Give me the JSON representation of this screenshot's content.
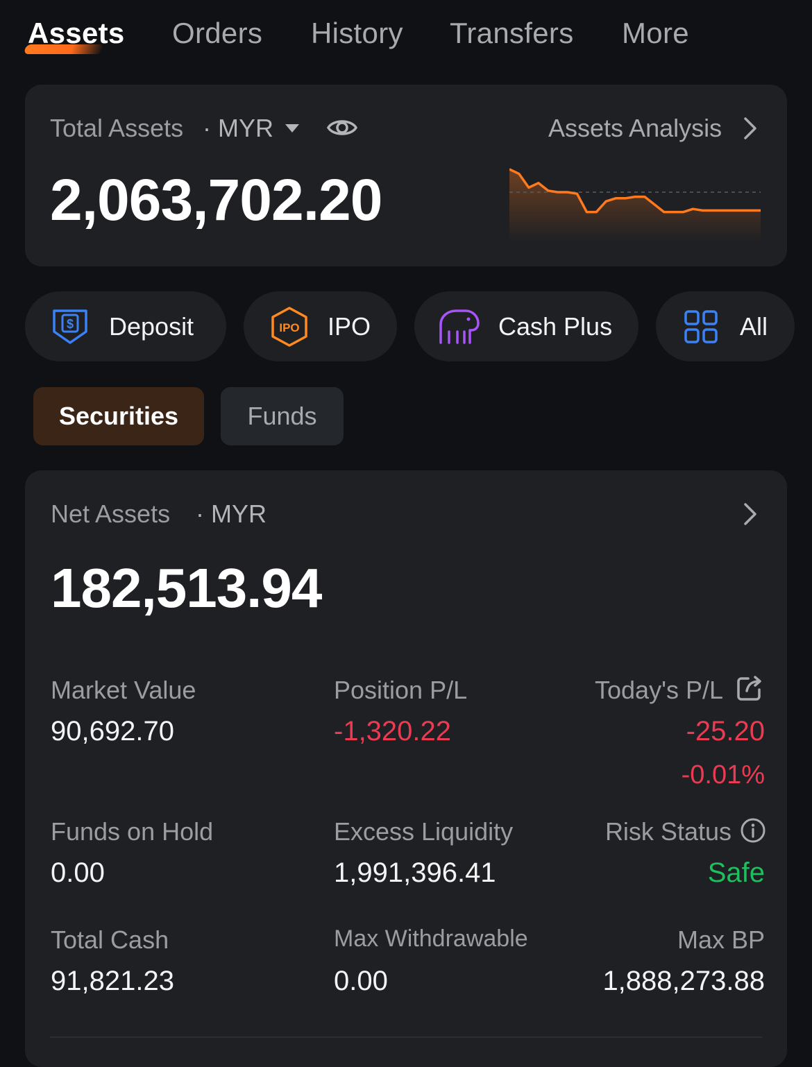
{
  "tabs": [
    {
      "label": "Assets",
      "active": true
    },
    {
      "label": "Orders"
    },
    {
      "label": "History"
    },
    {
      "label": "Transfers"
    },
    {
      "label": "More"
    }
  ],
  "total_assets": {
    "label": "Total Assets",
    "currency": "· MYR",
    "value": "2,063,702.20",
    "analysis_link": "Assets Analysis",
    "icons": [
      "caret-down-icon",
      "eye-icon",
      "chevron-right-icon"
    ],
    "sparkline": {
      "color": "#ff7a1f",
      "values": [
        100,
        97,
        88,
        91,
        86,
        85,
        85,
        84,
        72,
        72,
        79,
        81,
        81,
        82,
        82,
        77,
        72,
        72,
        72,
        74,
        73,
        73,
        73,
        73,
        73,
        73,
        73
      ],
      "baseline": 85
    }
  },
  "actions": [
    {
      "label": "Deposit",
      "icon": "deposit-icon",
      "color": "#3b82f6"
    },
    {
      "label": "IPO",
      "icon": "ipo-icon",
      "color": "#ff8a1f"
    },
    {
      "label": "Cash Plus",
      "icon": "elephant-icon",
      "color": "#a855f7"
    },
    {
      "label": "All",
      "icon": "grid-icon",
      "color": "#3b82f6"
    }
  ],
  "segments": [
    {
      "label": "Securities",
      "active": true
    },
    {
      "label": "Funds"
    }
  ],
  "net_assets": {
    "label": "Net Assets",
    "currency": "· MYR",
    "value": "182,513.94",
    "metrics": {
      "market_value": {
        "label": "Market Value",
        "value": "90,692.70"
      },
      "position_pl": {
        "label": "Position P/L",
        "value": "-1,320.22"
      },
      "todays_pl": {
        "label": "Today's P/L",
        "value": "-25.20",
        "percent": "-0.01%"
      },
      "funds_on_hold": {
        "label": "Funds on Hold",
        "value": "0.00"
      },
      "excess_liquidity": {
        "label": "Excess Liquidity",
        "value": "1,991,396.41"
      },
      "risk_status": {
        "label": "Risk Status",
        "value": "Safe"
      },
      "total_cash": {
        "label": "Total Cash",
        "value": "91,821.23"
      },
      "max_withdrawable": {
        "label": "Max Withdrawable",
        "value": "0.00"
      },
      "max_bp": {
        "label": "Max BP",
        "value": "1,888,273.88"
      }
    }
  },
  "colors": {
    "accent": "#ff7a1f",
    "loss": "#ea3b52",
    "safe": "#1fbf5f",
    "background": "#101114",
    "card": "#1f2023"
  }
}
